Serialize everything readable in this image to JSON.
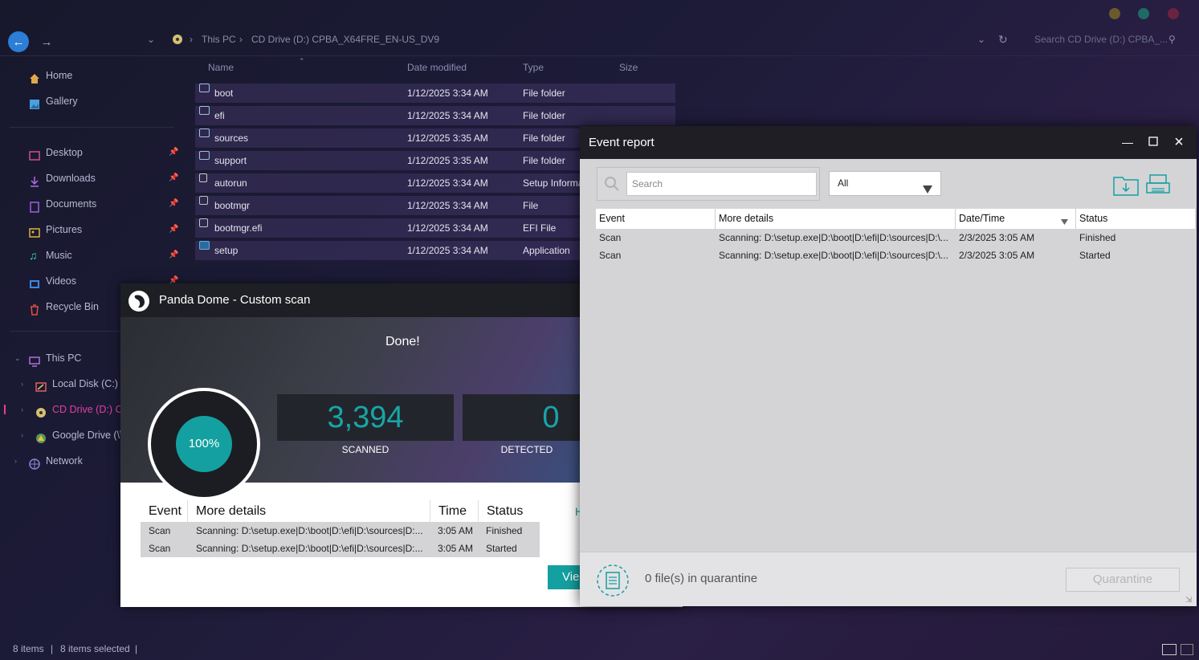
{
  "explorer": {
    "breadcrumb": [
      "This PC",
      "CD Drive (D:) CPBA_X64FRE_EN-US_DV9"
    ],
    "search_placeholder": "Search CD Drive (D:) CPBA_...",
    "sidebar_quick": [
      {
        "label": "Home",
        "icon": "home-icon"
      },
      {
        "label": "Gallery",
        "icon": "gallery-icon"
      }
    ],
    "sidebar_pinned": [
      {
        "label": "Desktop",
        "icon": "desktop-icon"
      },
      {
        "label": "Downloads",
        "icon": "download-icon"
      },
      {
        "label": "Documents",
        "icon": "document-icon"
      },
      {
        "label": "Pictures",
        "icon": "picture-icon"
      },
      {
        "label": "Music",
        "icon": "music-icon"
      },
      {
        "label": "Videos",
        "icon": "video-icon"
      },
      {
        "label": "Recycle Bin",
        "icon": "recycle-bin-icon"
      }
    ],
    "sidebar_tree": [
      {
        "label": "This PC",
        "icon": "pc-icon"
      },
      {
        "label": "Local Disk (C:)",
        "icon": "disk-icon"
      },
      {
        "label": "CD Drive (D:) CP",
        "icon": "cd-icon"
      },
      {
        "label": "Google Drive (\\\\",
        "icon": "google-drive-icon"
      },
      {
        "label": "Network",
        "icon": "network-icon"
      }
    ],
    "columns": {
      "name": "Name",
      "date": "Date modified",
      "type": "Type",
      "size": "Size"
    },
    "files": [
      {
        "name": "boot",
        "date": "1/12/2025 3:34 AM",
        "type": "File folder"
      },
      {
        "name": "efi",
        "date": "1/12/2025 3:34 AM",
        "type": "File folder"
      },
      {
        "name": "sources",
        "date": "1/12/2025 3:35 AM",
        "type": "File folder"
      },
      {
        "name": "support",
        "date": "1/12/2025 3:35 AM",
        "type": "File folder"
      },
      {
        "name": "autorun",
        "date": "1/12/2025 3:34 AM",
        "type": "Setup Informa"
      },
      {
        "name": "bootmgr",
        "date": "1/12/2025 3:34 AM",
        "type": "File"
      },
      {
        "name": "bootmgr.efi",
        "date": "1/12/2025 3:34 AM",
        "type": "EFI File"
      },
      {
        "name": "setup",
        "date": "1/12/2025 3:34 AM",
        "type": "Application"
      }
    ],
    "status": {
      "items": "8 items",
      "selected": "8 items selected"
    }
  },
  "panda": {
    "title": "Panda Dome - Custom scan",
    "done": "Done!",
    "progress": "100%",
    "scanned_value": "3,394",
    "scanned_label": "SCANNED",
    "detected_value": "0",
    "detected_label": "DETECTED",
    "table_headers": {
      "event": "Event",
      "details": "More details",
      "time": "Time",
      "status": "Status"
    },
    "rows": [
      {
        "event": "Scan",
        "details": "Scanning: D:\\setup.exe|D:\\boot|D:\\efi|D:\\sources|D:...",
        "time": "3:05 AM",
        "status": "Finished"
      },
      {
        "event": "Scan",
        "details": "Scanning: D:\\setup.exe|D:\\boot|D:\\efi|D:\\sources|D:...",
        "time": "3:05 AM",
        "status": "Started"
      }
    ],
    "side_link": "H",
    "view_button": "Vie"
  },
  "report": {
    "title": "Event report",
    "search_placeholder": "Search",
    "filter_value": "All",
    "headers": {
      "event": "Event",
      "details": "More details",
      "datetime": "Date/Time",
      "status": "Status"
    },
    "rows": [
      {
        "event": "Scan",
        "details": "Scanning: D:\\setup.exe|D:\\boot|D:\\efi|D:\\sources|D:\\...",
        "datetime": "2/3/2025 3:05 AM",
        "status": "Finished"
      },
      {
        "event": "Scan",
        "details": "Scanning: D:\\setup.exe|D:\\boot|D:\\efi|D:\\sources|D:\\...",
        "datetime": "2/3/2025 3:05 AM",
        "status": "Started"
      }
    ],
    "quarantine_text": "0 file(s) in quarantine",
    "quarantine_button": "Quarantine"
  },
  "colors": {
    "accent": "#14a0a0",
    "explorer_bg": "#1d1b38",
    "report_bg": "#d4d4d6"
  }
}
